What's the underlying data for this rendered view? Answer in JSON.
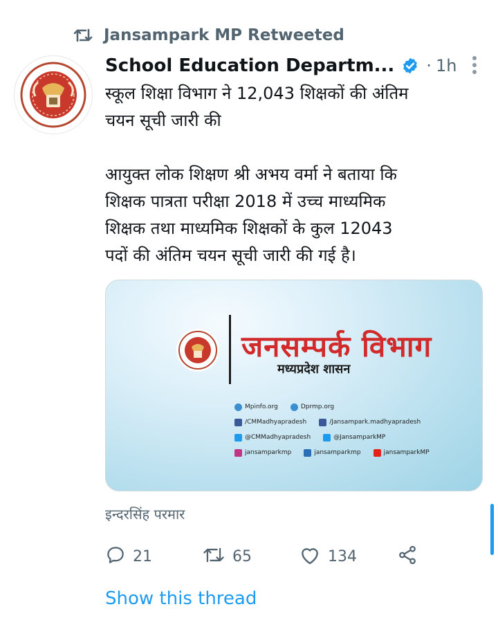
{
  "retweet": {
    "label": "Jansampark MP Retweeted"
  },
  "tweet": {
    "author": "School Education Departm...",
    "time_sep": "·",
    "time": "1h",
    "text_line1": "स्कूल शिक्षा विभाग ने 12,043 शिक्षकों की अंतिम",
    "text_line2": "चयन सूची जारी की",
    "text_line3": "आयुक्त लोक शिक्षण श्री अभय वर्मा ने बताया कि",
    "text_line4": "शिक्षक पात्रता परीक्षा 2018 में उच्च माध्यमिक",
    "text_line5": "शिक्षक तथा माध्यमिक शिक्षकों के कुल 12043",
    "text_line6": "पदों की अंतिम चयन सूची जारी की गई है।",
    "media": {
      "title": "जनसम्पर्क विभाग",
      "subtitle": "मध्यप्रदेश शासन",
      "link_web1": "Mpinfo.org",
      "link_web2": "Dprmp.org",
      "link_fb1": "/CMMadhyapradesh",
      "link_fb2": "/Jansampark.madhyapradesh",
      "link_tw1": "@CMMadhyapradesh",
      "link_tw2": "@JansamparkMP",
      "link_ig": "jansamparkmp",
      "link_koo": "jansamparkmp",
      "link_yt": "jansamparkMP"
    },
    "signature": "इन्दरसिंह परमार",
    "replies": "21",
    "retweets": "65",
    "likes": "134"
  },
  "show_thread": "Show this thread",
  "colors": {
    "accent": "#1d9bf0",
    "muted": "#536471",
    "brand_red": "#d22a2a"
  },
  "icons": [
    "retweet-icon",
    "verified-badge-icon",
    "more-icon",
    "reply-icon",
    "like-icon",
    "share-icon"
  ]
}
